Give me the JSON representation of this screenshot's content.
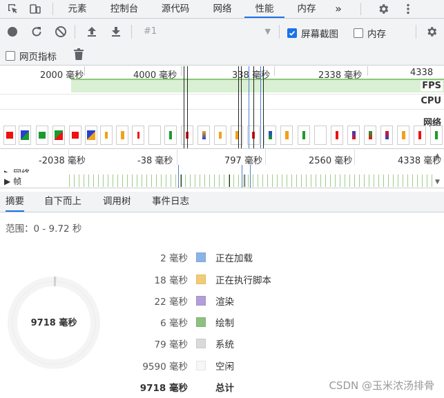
{
  "tabs": {
    "items": [
      "元素",
      "控制台",
      "源代码",
      "网络",
      "性能",
      "内存"
    ],
    "active": "性能",
    "more": "»"
  },
  "icons": {
    "inspect": "inspect-cursor-icon",
    "device": "device-toolbar-icon",
    "settings": "gear-icon",
    "menu": "kebab-menu-icon",
    "record": "record-icon",
    "reload": "reload-record-icon",
    "clear": "clear-icon",
    "upload": "upload-profile-icon",
    "download": "download-profile-icon",
    "trash": "trash-icon"
  },
  "toolbar": {
    "profile_select": "#1",
    "screenshots_label": "屏幕截图",
    "screenshots_checked": true,
    "memory_label": "内存",
    "memory_checked": false,
    "web_vitals_label": "网页指标",
    "web_vitals_checked": false
  },
  "overview": {
    "ruler": [
      "2000 毫秒",
      "4000 毫秒",
      "338 毫秒",
      "2338 毫秒",
      "4338 毫秒"
    ],
    "lanes": [
      "FPS",
      "CPU",
      "网络"
    ]
  },
  "detail": {
    "ruler": [
      "-2038 毫秒",
      "-38 毫秒",
      "797 毫秒",
      "2560 毫秒",
      "4338 毫秒"
    ],
    "network_row": "网络",
    "frames_row": "帧"
  },
  "bottom_tabs": {
    "items": [
      "摘要",
      "自下而上",
      "调用树",
      "事件日志"
    ],
    "active": "摘要"
  },
  "summary": {
    "range": "范围：0 - 9.72 秒",
    "total_label": "9718 毫秒",
    "rows": [
      {
        "value": "2 毫秒",
        "label": "正在加载",
        "color": "#8ab4e8"
      },
      {
        "value": "18 毫秒",
        "label": "正在执行脚本",
        "color": "#f2cc74"
      },
      {
        "value": "22 毫秒",
        "label": "渲染",
        "color": "#b39ddb"
      },
      {
        "value": "6 毫秒",
        "label": "绘制",
        "color": "#8cc180"
      },
      {
        "value": "79 毫秒",
        "label": "系统",
        "color": "#dadada"
      },
      {
        "value": "9590 毫秒",
        "label": "空闲",
        "color": "#f7f7f7"
      }
    ],
    "total_row": {
      "value": "9718 毫秒",
      "label": "总计"
    }
  },
  "watermark": "CSDN @玉米浓汤排骨"
}
